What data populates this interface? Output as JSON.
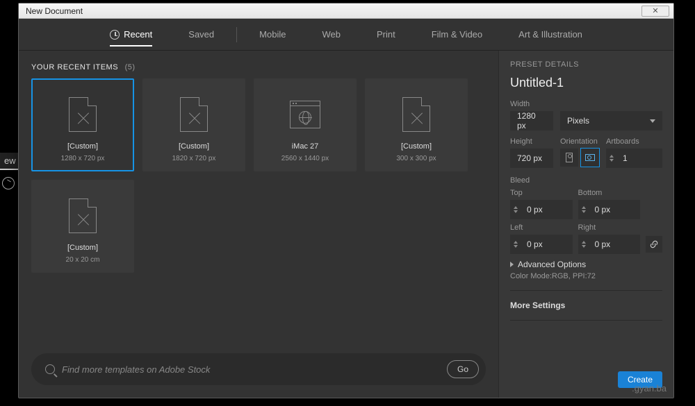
{
  "backdrop": {
    "label": "ew"
  },
  "window": {
    "title": "New Document",
    "close_glyph": "✕"
  },
  "tabs": [
    {
      "label": "Recent",
      "active": true,
      "icon": "recent"
    },
    {
      "label": "Saved"
    },
    {
      "label": "Mobile"
    },
    {
      "label": "Web"
    },
    {
      "label": "Print"
    },
    {
      "label": "Film & Video"
    },
    {
      "label": "Art & Illustration"
    }
  ],
  "recents": {
    "heading": "YOUR RECENT ITEMS",
    "count": "(5)",
    "items": [
      {
        "title": "[Custom]",
        "sub": "1280 x 720 px",
        "icon": "doc",
        "selected": true
      },
      {
        "title": "[Custom]",
        "sub": "1820 x 720 px",
        "icon": "doc"
      },
      {
        "title": "iMac 27",
        "sub": "2560 x 1440 px",
        "icon": "web"
      },
      {
        "title": "[Custom]",
        "sub": "300 x 300 px",
        "icon": "doc"
      },
      {
        "title": "[Custom]",
        "sub": "20 x 20 cm",
        "icon": "doc"
      }
    ]
  },
  "search": {
    "placeholder": "Find more templates on Adobe Stock",
    "go_label": "Go"
  },
  "preset": {
    "section_title": "PRESET DETAILS",
    "doc_name": "Untitled-1",
    "width_label": "Width",
    "width_value": "1280 px",
    "units_label": "Pixels",
    "height_label": "Height",
    "height_value": "720 px",
    "orientation_label": "Orientation",
    "artboards_label": "Artboards",
    "artboards_value": "1",
    "bleed_label": "Bleed",
    "top_label": "Top",
    "top_value": "0 px",
    "bottom_label": "Bottom",
    "bottom_value": "0 px",
    "left_label": "Left",
    "left_value": "0 px",
    "right_label": "Right",
    "right_value": "0 px",
    "advanced_label": "Advanced Options",
    "mode_line": "Color Mode:RGB, PPI:72",
    "more_label": "More Settings",
    "create_label": "Create",
    "watermark": ".gyan.ba"
  }
}
